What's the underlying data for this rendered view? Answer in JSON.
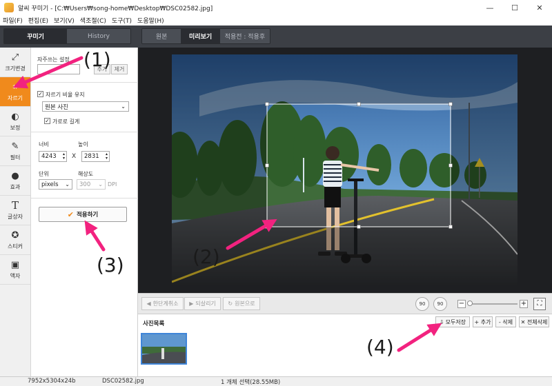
{
  "window": {
    "title": "알씨 꾸미기 - [C:₩Users₩song-home₩Desktop₩DSC02582.jpg]",
    "controls": [
      "—",
      "☐",
      "✕"
    ]
  },
  "menu": [
    "파일(F)",
    "편집(E)",
    "보기(V)",
    "색조절(C)",
    "도구(T)",
    "도움말(H)"
  ],
  "top_tabs": {
    "left": [
      "꾸미기",
      "History"
    ],
    "right": [
      "원본",
      "미리보기",
      "적용전 : 적용후"
    ]
  },
  "tools": [
    {
      "label": "크기변경",
      "icon": "resize-icon",
      "glyph": "⤢"
    },
    {
      "label": "자르기",
      "icon": "crop-icon",
      "glyph": "⌗"
    },
    {
      "label": "보정",
      "icon": "adjust-icon",
      "glyph": "◐"
    },
    {
      "label": "필터",
      "icon": "filter-wand-icon",
      "glyph": "✎"
    },
    {
      "label": "효과",
      "icon": "drop-icon",
      "glyph": "●"
    },
    {
      "label": "글상자",
      "icon": "text-icon",
      "glyph": "T"
    },
    {
      "label": "스티커",
      "icon": "sticker-icon",
      "glyph": "✪"
    },
    {
      "label": "액자",
      "icon": "frame-icon",
      "glyph": "▣"
    }
  ],
  "crop_panel": {
    "favorites_label": "자주쓰는 설정",
    "add_label": "추가",
    "remove_label": "제거",
    "keep_ratio_label": "자르기 비율 유지",
    "ratio_value": "원본 사진",
    "landscape_label": "가로로 길게",
    "width_label": "너비",
    "height_label": "높이",
    "width_value": "4243",
    "height_value": "2831",
    "times": "X",
    "unit_label": "단위",
    "unit_value": "pixels",
    "res_label": "해상도",
    "res_value": "300",
    "dpi": "DPI",
    "apply_label": "적용하기"
  },
  "actions": {
    "undo": "한단계취소",
    "redo": "되살리기",
    "original": "원본으로",
    "rotate_left": "90",
    "rotate_right": "90"
  },
  "photolist": {
    "title": "사진목록",
    "save_all": "모두저장",
    "add": "+ 추가",
    "delete": "- 삭제",
    "delete_all": "✕ 전체삭제"
  },
  "status": {
    "dims": "7952x5304x24b",
    "file": "DSC02582.jpg",
    "selection": "1 개체 선택(28.55MB)"
  },
  "annotations": [
    "(1)",
    "(2)",
    "(3)",
    "(4)"
  ],
  "colors": {
    "accent_orange": "#f08a1c",
    "arrow_pink": "#f2227f",
    "dark_toolbar": "#3c3f45",
    "canvas_bg": "#1e1f22",
    "selection_blue": "#3f85d8"
  }
}
